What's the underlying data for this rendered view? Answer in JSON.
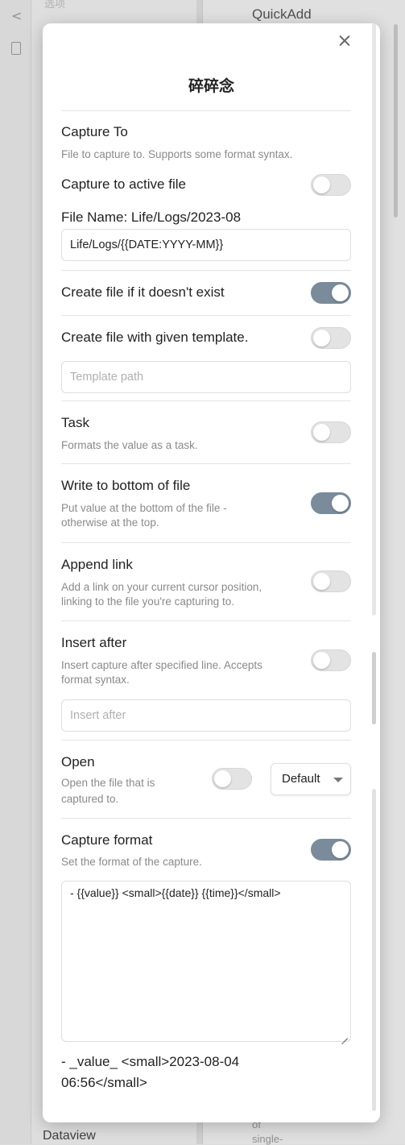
{
  "background": {
    "faint_text": "选项",
    "right_panel_title": "QuickAdd",
    "bottom_left_label": "Dataview",
    "bottom_snip_1": "of",
    "bottom_snip_2": "single-"
  },
  "modal": {
    "title": "碎碎念",
    "capture_to": {
      "label": "Capture To",
      "description": "File to capture to. Supports some format syntax."
    },
    "capture_active": {
      "label": "Capture to active file",
      "enabled": false
    },
    "file_name": {
      "label": "File Name: Life/Logs/2023-08",
      "value": "Life/Logs/{{DATE:YYYY-MM}}"
    },
    "create_if_missing": {
      "label": "Create file if it doesn't exist",
      "enabled": true
    },
    "create_with_template": {
      "label": "Create file with given template.",
      "enabled": false,
      "placeholder": "Template path"
    },
    "task": {
      "label": "Task",
      "description": "Formats the value as a task.",
      "enabled": false
    },
    "write_bottom": {
      "label": "Write to bottom of file",
      "description_line1": "Put value at the bottom of the file -",
      "description_line2": "otherwise at the top.",
      "enabled": true
    },
    "append_link": {
      "label": "Append link",
      "description_line1": "Add a link on your current cursor position,",
      "description_line2": "linking to the file you're capturing to.",
      "enabled": false
    },
    "insert_after": {
      "label": "Insert after",
      "description_line1": "Insert capture after specified line. Accepts",
      "description_line2": "format syntax.",
      "enabled": false,
      "placeholder": "Insert after"
    },
    "open": {
      "label": "Open",
      "description_line1": "Open the file that is",
      "description_line2": "captured to.",
      "enabled": false,
      "select_value": "Default"
    },
    "capture_format": {
      "label": "Capture format",
      "description": "Set the format of the capture.",
      "enabled": true,
      "value": "- {{value}} <small>{{date}} {{time}}</small>"
    },
    "preview": {
      "line1": "- _value_ <small>2023-08-04",
      "line2": "06:56</small>"
    }
  }
}
